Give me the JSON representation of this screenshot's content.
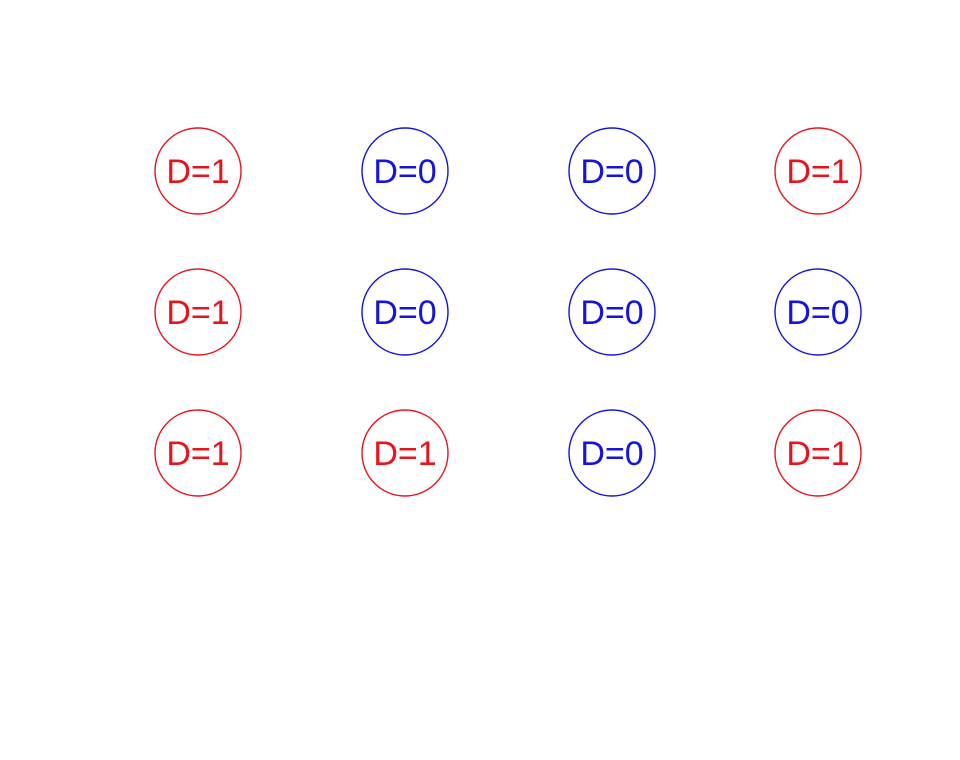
{
  "colors": {
    "treated": "#e8141c",
    "control": "#1414dc",
    "background": "#ffffff"
  },
  "grid": {
    "rows": 3,
    "cols": 4,
    "nodes": [
      {
        "row": 1,
        "col": 1,
        "label": "D=1",
        "group": "treated"
      },
      {
        "row": 1,
        "col": 2,
        "label": "D=0",
        "group": "control"
      },
      {
        "row": 1,
        "col": 3,
        "label": "D=0",
        "group": "control"
      },
      {
        "row": 1,
        "col": 4,
        "label": "D=1",
        "group": "treated"
      },
      {
        "row": 2,
        "col": 1,
        "label": "D=1",
        "group": "treated"
      },
      {
        "row": 2,
        "col": 2,
        "label": "D=0",
        "group": "control"
      },
      {
        "row": 2,
        "col": 3,
        "label": "D=0",
        "group": "control"
      },
      {
        "row": 2,
        "col": 4,
        "label": "D=0",
        "group": "control"
      },
      {
        "row": 3,
        "col": 1,
        "label": "D=1",
        "group": "treated"
      },
      {
        "row": 3,
        "col": 2,
        "label": "D=1",
        "group": "treated"
      },
      {
        "row": 3,
        "col": 3,
        "label": "D=0",
        "group": "control"
      },
      {
        "row": 3,
        "col": 4,
        "label": "D=1",
        "group": "treated"
      }
    ]
  }
}
